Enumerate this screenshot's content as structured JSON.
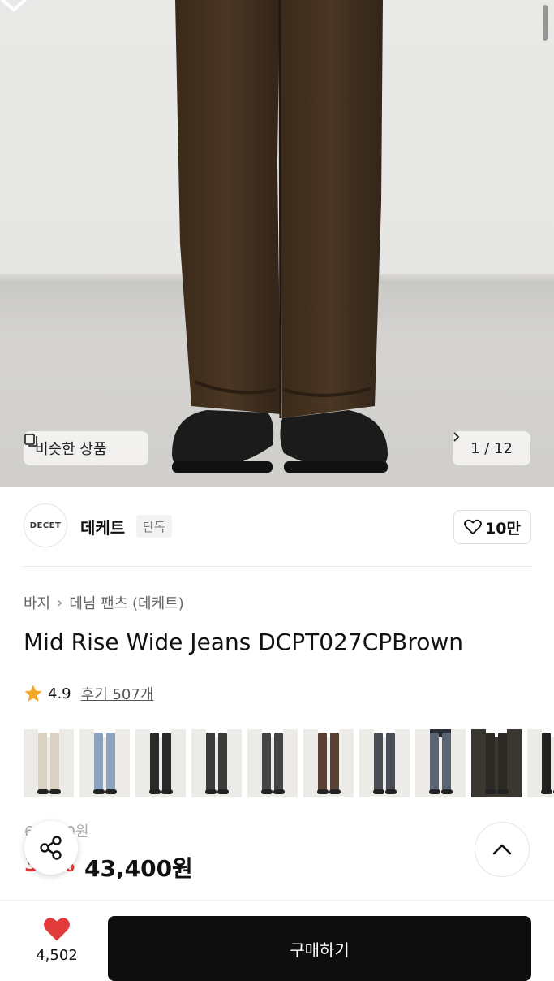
{
  "gallery": {
    "similar_label": "비슷한 상품",
    "counter": "1 / 12"
  },
  "brand": {
    "logo_text": "DECET",
    "name": "데케트",
    "tag": "단독",
    "likes": "10만"
  },
  "product": {
    "breadcrumb": [
      "바지",
      "데님 팬츠 (데케트)"
    ],
    "title": "Mid Rise Wide Jeans DCPT027CPBrown",
    "rating": "4.9",
    "reviews": "후기 507개"
  },
  "thumbnails": [
    {
      "name": "light-beige",
      "color": "#d9d2c3"
    },
    {
      "name": "light-blue",
      "color": "#8ba3bd"
    },
    {
      "name": "black",
      "color": "#2a2a2a"
    },
    {
      "name": "charcoal",
      "color": "#3b3b3b"
    },
    {
      "name": "dark-grey",
      "color": "#444444"
    },
    {
      "name": "brown",
      "color": "#5a3f33"
    },
    {
      "name": "grey-blue",
      "color": "#4a4d55"
    },
    {
      "name": "group-shot",
      "color": "#5b6472"
    },
    {
      "name": "dark-detail",
      "color": "#2b2a25"
    },
    {
      "name": "black-cut",
      "color": "#222222"
    }
  ],
  "price": {
    "original": "69,900원",
    "discount": "38%",
    "sale": "43,400원"
  },
  "bottom_bar": {
    "wish_count": "4,502",
    "buy_label": "구매하기"
  },
  "colors": {
    "accent_red": "#e23b3b",
    "star": "#f5a623",
    "buy_button": "#0d0d0d"
  }
}
